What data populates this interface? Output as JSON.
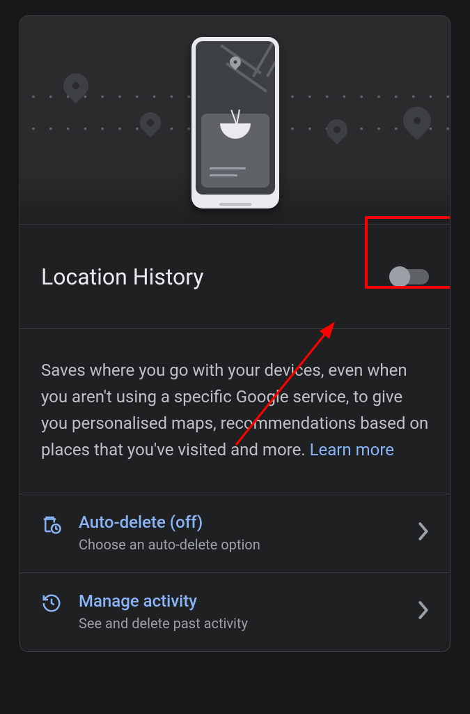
{
  "header": {
    "title": "Location History",
    "toggle_state": "off"
  },
  "description": {
    "text": "Saves where you go with your devices, even when you aren't using a specific Google service, to give you personalised maps, recommendations based on places that you've visited and more. ",
    "learn_more_label": "Learn more"
  },
  "actions": [
    {
      "icon": "trash-clock-icon",
      "title": "Auto-delete (off)",
      "subtitle": "Choose an auto-delete option"
    },
    {
      "icon": "history-icon",
      "title": "Manage activity",
      "subtitle": "See and delete past activity"
    }
  ]
}
